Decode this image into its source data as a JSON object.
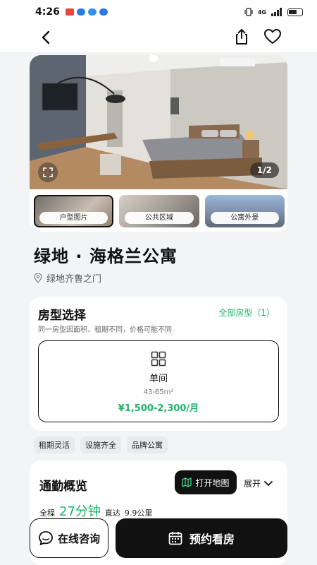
{
  "status_bar": {
    "time": "4:26",
    "network": "4G",
    "icons": [
      "red-app-icon",
      "blue-app-icon",
      "browser-icon",
      "blue-app-icon-2",
      "vibrate-icon",
      "signal-icon",
      "battery-icon"
    ]
  },
  "nav": {
    "icons": [
      "back-arrow-icon",
      "share-icon",
      "heart-icon"
    ]
  },
  "gallery": {
    "counter": "1/2",
    "thumbnails": [
      {
        "label": "户型图片",
        "active": true
      },
      {
        "label": "公共区域",
        "active": false
      },
      {
        "label": "公寓外景",
        "active": false
      }
    ]
  },
  "property": {
    "title": "绿地 · 海格兰公寓",
    "location": "绿地齐鲁之门"
  },
  "room_selection": {
    "heading": "房型选择",
    "all_types_link": "全部房型（1）",
    "subtitle": "同一房型因面积、租期不同，价格可能不同",
    "option": {
      "name": "单间",
      "area": "43-65m²",
      "price": "¥1,500-2,300/月"
    }
  },
  "tags": [
    "租期灵活",
    "设施齐全",
    "品牌公寓"
  ],
  "commute": {
    "heading": "通勤概览",
    "map_button": "打开地图",
    "expand_label": "展开",
    "mode_label": "全程",
    "duration": "27分钟",
    "drive_label": "直达",
    "distance": "9.9公里"
  },
  "bottom_bar": {
    "consult_label": "在线咨询",
    "book_label": "预约看房"
  },
  "colors": {
    "accent_green": "#1bb36a",
    "dark": "#111111"
  }
}
